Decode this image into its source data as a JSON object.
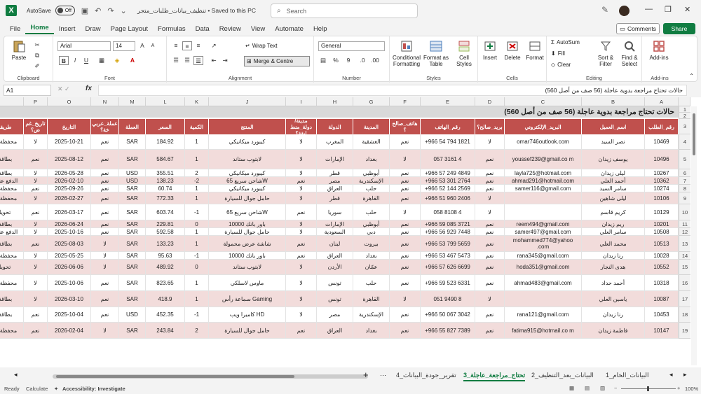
{
  "titlebar": {
    "autosave_label": "AutoSave",
    "autosave_state": "Off",
    "doc_title": "تنظيف_بيانات_طلبات_متجر • Saved to this PC",
    "search_placeholder": "Search"
  },
  "menu": [
    "File",
    "Home",
    "Insert",
    "Draw",
    "Page Layout",
    "Formulas",
    "Data",
    "Review",
    "View",
    "Automate",
    "Help"
  ],
  "menu_active": "Home",
  "comments_label": "Comments",
  "share_label": "Share",
  "ribbon": {
    "clipboard": {
      "paste": "Paste",
      "label": "Clipboard"
    },
    "font": {
      "name": "Arial",
      "size": "14",
      "label": "Font"
    },
    "alignment": {
      "wrap": "Wrap Text",
      "merge": "Merge & Centre",
      "label": "Alignment"
    },
    "number": {
      "format": "General",
      "label": "Number"
    },
    "styles": {
      "cond": "Conditional Formatting",
      "table": "Format as Table",
      "cell": "Cell Styles",
      "label": "Styles"
    },
    "cells": {
      "insert": "Insert",
      "delete": "Delete",
      "format": "Format",
      "label": "Cells"
    },
    "editing": {
      "autosum": "AutoSum",
      "fill": "Fill",
      "clear": "Clear",
      "sort": "Sort & Filter",
      "find": "Find & Select",
      "label": "Editing"
    },
    "addins": {
      "btn": "Add-ins",
      "label": "Add-ins"
    }
  },
  "namebox": "A1",
  "formula": "حالات تحتاج مراجعة بدوية عاجلة (56 صف من أصل 560)",
  "columns": [
    "A",
    "B",
    "C",
    "D",
    "E",
    "F",
    "G",
    "H",
    "I",
    "J",
    "K",
    "L",
    "M",
    "N",
    "O",
    "P",
    "Q"
  ],
  "banner": "حالات تحتاج مراجعة بدوية عاجلة (56 صف من أصل 560)",
  "headers": [
    "رقم_الطلب",
    "اسم_العميل",
    "البريد_الإلكتروني",
    "بريد_صالح؟",
    "رقم_الهاتف",
    "هاتف_صالح ؟",
    "المدينة",
    "الدولة",
    "مدينة/دولة_منط ابقة؟",
    "المنتج",
    "الكمية",
    "السعر",
    "العملة",
    "عملة_عربي خة؟",
    "التاريخ",
    "تاريخ_غم ض؟",
    "طريقة_الدفع",
    ""
  ],
  "rows": [
    {
      "n": "4",
      "h": 22,
      "c": [
        "10469",
        "نصر السيد",
        "omar746outlook.com",
        "لا",
        "+966 54 794 1821",
        "نعم",
        "الغشقية",
        "المغرب",
        "لا",
        "كيبورد ميكانيكي",
        "1",
        "184.92",
        "SAR",
        "نعم",
        "2025-10-21",
        "لا",
        "محفظة إلكترونية",
        "صيغة بريد غ"
      ]
    },
    {
      "n": "5",
      "h": 28,
      "c": [
        "10496",
        "يوسف زيدان",
        "youssef239@gmail.co m",
        "نعم",
        "057 3161 4",
        "لا",
        "بغداد",
        "الإمارات",
        "لا",
        "لابتوب ستاند",
        "1",
        "584.67",
        "SAR",
        "نعم",
        "2025-08-12",
        "نعم",
        "بطاقة ائتمان",
        "صيغة هاتف الدولة الم"
      ]
    },
    {
      "n": "6",
      "h": 11,
      "c": [
        "10267",
        "ليلى زيدان",
        "layla725@hotmail.com",
        "نعم",
        "+966 57 249 4849",
        "نعم",
        "أبوظبي",
        "قطر",
        "لا",
        "كيبورد ميكانيكي",
        "2",
        "355.51",
        "USD",
        "نعم",
        "2026-05-28",
        "لا",
        "بطاقة ائتمان",
        "المدينة"
      ]
    },
    {
      "n": "7",
      "h": 11,
      "c": [
        "10362",
        "أحمد العلي",
        "ahmad291@hotmail.com",
        "نعم",
        "+966 53 301 2764",
        "نعم",
        "الإسكندرية",
        "مصر",
        "نعم",
        "شاحن سريع 65W",
        "-2",
        "138.23",
        "USD",
        "نعم",
        "2026-02-10",
        "لا",
        "الدفع عند التسليم",
        "الكمية"
      ]
    },
    {
      "n": "8",
      "h": 11,
      "c": [
        "10274",
        "سامر السيد",
        "samer116@gmail.com",
        "نعم",
        "+966 52 144 2569",
        "نعم",
        "حلب",
        "العراق",
        "لا",
        "كيبورد ميكانيكي",
        "1",
        "60.74",
        "SAR",
        "نعم",
        "2025-09-26",
        "نعم",
        "محفظة إلكترونية",
        "المدينة"
      ]
    },
    {
      "n": "9",
      "h": 17,
      "c": [
        "10106",
        "ليلى شاهين",
        "",
        "لا",
        "+966 51 960 2406",
        "نعم",
        "القاهرة",
        "قطر",
        "لا",
        "حامل جوال للسيارة",
        "1",
        "772.33",
        "SAR",
        "نعم",
        "2026-02-27",
        "لا",
        "محفظة إلكترونية",
        "بريد ناقص"
      ]
    },
    {
      "n": "10",
      "h": 23,
      "c": [
        "10129",
        "كريم قاسم",
        "",
        "لا",
        "058 8108 4",
        "لا",
        "حلب",
        "سوريا",
        "نعم",
        "شاحن سريع 65W",
        "-1",
        "603.74",
        "SAR",
        "نعم",
        "2026-03-17",
        "نعم",
        "تحويل بنكي",
        "بريد ناقص"
      ]
    },
    {
      "n": "11",
      "h": 11,
      "c": [
        "10201",
        "ريم زيدان",
        "reem494@gmail.com",
        "نعم",
        "+966 59 085 3721",
        "نعم",
        "أبوظبي",
        "الإمارات",
        "لا",
        "باور بانك 10000",
        "0",
        "229.81",
        "SAR",
        "نعم",
        "2026-06-24",
        "لا",
        "بطاقة ائتمان",
        "المدينة"
      ]
    },
    {
      "n": "12",
      "h": 11,
      "c": [
        "10508",
        "سامر العلي",
        "samer497@gmail.com",
        "نعم",
        "+966 56 929 7448",
        "نعم",
        "دبي",
        "السعودية",
        "لا",
        "حامل جوال للسيارة",
        "1",
        "592.58",
        "SAR",
        "نعم",
        "2025-10-16",
        "لا",
        "الدفع عند التسليم",
        "المدينة"
      ]
    },
    {
      "n": "13",
      "h": 23,
      "c": [
        "10513",
        "محمد العلي",
        "mohammed774@yahoo .com",
        "نعم",
        "+966 53 799 5659",
        "نعم",
        "بيروت",
        "لبنان",
        "نعم",
        "شاشة عرض محمولة",
        "1",
        "133.23",
        "SAR",
        "لا",
        "2025-08-03",
        "نعم",
        "بطاقة ائتمان",
        "المدينة لا تطا تاريخ غا"
      ]
    },
    {
      "n": "14",
      "h": 11,
      "c": [
        "10028",
        "رنا زيدان",
        "rana345@gmail.com",
        "نعم",
        "+966 53 467 5473",
        "نعم",
        "بغداد",
        "العراق",
        "نعم",
        "باور بانك 10000",
        "-1",
        "95.63",
        "SAR",
        "لا",
        "2025-05-25",
        "لا",
        "محفظة إلكترونية",
        "بريد ناقص"
      ]
    },
    {
      "n": "15",
      "h": 22,
      "c": [
        "10552",
        "هدى النجار",
        "hoda351@gmail.com",
        "نعم",
        "+966 57 626 6699",
        "نعم",
        "عمّان",
        "الأردن",
        "لا",
        "لابتوب ستاند",
        "0",
        "489.92",
        "SAR",
        "لا",
        "2026-06-06",
        "لا",
        "تحويل بنكي",
        "كمية غير"
      ]
    },
    {
      "n": "16",
      "h": 23,
      "c": [
        "10318",
        "أحمد حداد",
        "ahmad483@gmail.com",
        "نعم",
        "+966 59 523 6331",
        "نعم",
        "حلب",
        "تونس",
        "لا",
        "ماوس لاسلكي",
        "1",
        "823.65",
        "SAR",
        "نعم",
        "2025-10-06",
        "لا",
        "محفظة إلكترونية",
        "المدينة لا تا"
      ]
    },
    {
      "n": "17",
      "h": 23,
      "c": [
        "10087",
        "ياسين العلي",
        "",
        "لا",
        "051 9490 8",
        "لا",
        "القاهرة",
        "تونس",
        "لا",
        "سماعة رأس Gaming",
        "1",
        "418.9",
        "SAR",
        "نعم",
        "2026-03-10",
        "لا",
        "بطاقة ائتمان",
        "بريد ناقص"
      ]
    },
    {
      "n": "18",
      "h": 22,
      "c": [
        "10453",
        "رنا زيدان",
        "rana121@gmail.com",
        "نعم",
        "+966 50 067 3042",
        "نعم",
        "الإسكندرية",
        "مصر",
        "لا",
        "كاميرا ويب HD",
        "-1",
        "452.35",
        "USD",
        "نعم",
        "2025-10-04",
        "نعم",
        "بطاقة ائتمان",
        "كمية غير"
      ]
    },
    {
      "n": "19",
      "h": 23,
      "c": [
        "10147",
        "فاطمة زيدان",
        "fatima915@hotmail.co m",
        "نعم",
        "+966 55 827 7389",
        "نعم",
        "بغداد",
        "العراق",
        "نعم",
        "حامل جوال للسيارة",
        "2",
        "243.84",
        "SAR",
        "لا",
        "2026-02-04",
        "نعم",
        "محفظة إلكترونية",
        "المدينة"
      ]
    }
  ],
  "sheet_tabs": [
    "البيانات_الخام_1",
    "البيانات_بعد_التنظيف_2",
    "تحتاج_مراجعة_عاجلة_3",
    "تقرير_جودة_البيانات_4"
  ],
  "sheet_active": "تحتاج_مراجعة_عاجلة_3",
  "status": {
    "ready": "Ready",
    "calc": "Calculate",
    "access": "Accessibility: Investigate",
    "zoom": "100%"
  }
}
